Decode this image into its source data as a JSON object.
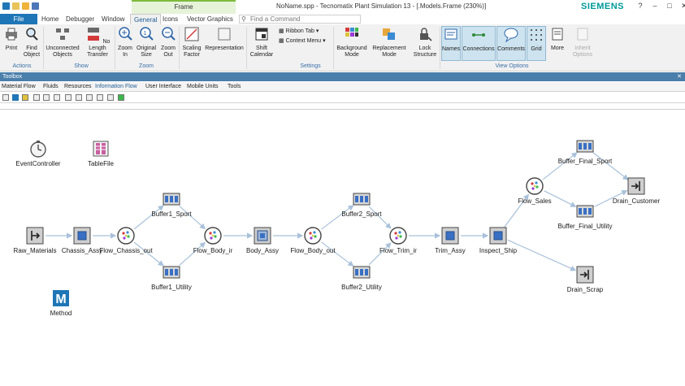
{
  "titlebar": {
    "context_tab": "Frame",
    "document_title": "NoName.spp - Tecnomatix Plant Simulation 13 - [.Models.Frame  (230%)]",
    "brand": "SIEMENS",
    "minimize": "?",
    "restore": "–",
    "maximize": "□",
    "close": "✕"
  },
  "ribbon_tabs": [
    "File",
    "Home",
    "Debugger",
    "Window",
    "General",
    "Icons",
    "Vector Graphics"
  ],
  "search": {
    "placeholder": "Find a Command"
  },
  "ribbon": {
    "buttons": [
      {
        "label": "Print",
        "icon": "printer-icon"
      },
      {
        "label": "Find Object",
        "icon": "find-icon"
      },
      {
        "label": "Unconnected Objects",
        "icon": "unconnected-icon"
      },
      {
        "label": "No Length Transfer",
        "icon": "transfer-icon"
      },
      {
        "label": "Zoom In",
        "icon": "zoom-in-icon"
      },
      {
        "label": "Original Size",
        "icon": "zoom-original-icon"
      },
      {
        "label": "Zoom Out",
        "icon": "zoom-out-icon"
      },
      {
        "label": "Scaling Factor",
        "icon": "scaling-icon"
      },
      {
        "label": "Representation",
        "icon": "representation-icon"
      },
      {
        "label": "Shift Calendar",
        "icon": "calendar-icon"
      },
      {
        "label": "Background Mode",
        "icon": "palette-icon"
      },
      {
        "label": "Replacement Mode",
        "icon": "replacement-icon"
      },
      {
        "label": "Lock Structure",
        "icon": "lock-icon"
      },
      {
        "label": "Names",
        "icon": "names-icon"
      },
      {
        "label": "Connections",
        "icon": "connections-icon"
      },
      {
        "label": "Comments",
        "icon": "comments-icon"
      },
      {
        "label": "Grid",
        "icon": "grid-icon"
      },
      {
        "label": "More",
        "icon": "more-icon"
      },
      {
        "label": "Inherit Options",
        "icon": "inherit-icon"
      }
    ],
    "small_items": [
      "Ribbon Tab",
      "Context Menu"
    ],
    "groups": [
      "Actions",
      "Show",
      "Zoom",
      "Settings",
      "View Options"
    ]
  },
  "toolbox": {
    "title": "Toolbox",
    "close": "✕",
    "tabs": [
      "Material Flow",
      "Fluids",
      "Resources",
      "Information Flow",
      "User Interface",
      "Mobile Units",
      "Tools"
    ],
    "active_tab": "Information Flow"
  },
  "model": {
    "nodes": [
      {
        "id": "EventController",
        "label": "EventController",
        "kind": "event-controller"
      },
      {
        "id": "TableFile",
        "label": "TableFile",
        "kind": "table"
      },
      {
        "id": "Method",
        "label": "Method",
        "kind": "method"
      },
      {
        "id": "Raw_Materials",
        "label": "Raw_Materials",
        "kind": "source"
      },
      {
        "id": "Chassis_Assy",
        "label": "Chassis_Assy",
        "kind": "station"
      },
      {
        "id": "Flow_Chassis_out",
        "label": "Flow_Chassis_out",
        "kind": "flow"
      },
      {
        "id": "Buffer1_Sport",
        "label": "Buffer1_Sport",
        "kind": "buffer"
      },
      {
        "id": "Buffer1_Utility",
        "label": "Buffer1_Utility",
        "kind": "buffer"
      },
      {
        "id": "Flow_Body_in",
        "label": "Flow_Body_ir",
        "kind": "flow"
      },
      {
        "id": "Body_Assy",
        "label": "Body_Assy",
        "kind": "assembly"
      },
      {
        "id": "Flow_Body_out",
        "label": "Flow_Body_out",
        "kind": "flow"
      },
      {
        "id": "Buffer2_Sport",
        "label": "Buffer2_Sport",
        "kind": "buffer"
      },
      {
        "id": "Buffer2_Utility",
        "label": "Buffer2_Utility",
        "kind": "buffer"
      },
      {
        "id": "Flow_Trim_in",
        "label": "Flow_Trim_ir",
        "kind": "flow"
      },
      {
        "id": "Trim_Assy",
        "label": "Trim_Assy",
        "kind": "station"
      },
      {
        "id": "Inspect_Ship",
        "label": "Inspect_Ship",
        "kind": "station"
      },
      {
        "id": "Flow_Sales",
        "label": "Flow_Sales",
        "kind": "flow"
      },
      {
        "id": "Buffer_Final_Sport",
        "label": "Buffer_Final_Sport",
        "kind": "buffer"
      },
      {
        "id": "Buffer_Final_Utility",
        "label": "Buffer_Final_Utility",
        "kind": "buffer"
      },
      {
        "id": "Drain_Customer",
        "label": "Drain_Customer",
        "kind": "drain"
      },
      {
        "id": "Drain_Scrap",
        "label": "Drain_Scrap",
        "kind": "drain"
      }
    ],
    "connections": [
      [
        "Raw_Materials",
        "Chassis_Assy"
      ],
      [
        "Chassis_Assy",
        "Flow_Chassis_out"
      ],
      [
        "Flow_Chassis_out",
        "Buffer1_Sport"
      ],
      [
        "Flow_Chassis_out",
        "Buffer1_Utility"
      ],
      [
        "Buffer1_Sport",
        "Flow_Body_in"
      ],
      [
        "Buffer1_Utility",
        "Flow_Body_in"
      ],
      [
        "Flow_Body_in",
        "Body_Assy"
      ],
      [
        "Body_Assy",
        "Flow_Body_out"
      ],
      [
        "Flow_Body_out",
        "Buffer2_Sport"
      ],
      [
        "Flow_Body_out",
        "Buffer2_Utility"
      ],
      [
        "Buffer2_Sport",
        "Flow_Trim_in"
      ],
      [
        "Buffer2_Utility",
        "Flow_Trim_in"
      ],
      [
        "Flow_Trim_in",
        "Trim_Assy"
      ],
      [
        "Trim_Assy",
        "Inspect_Ship"
      ],
      [
        "Inspect_Ship",
        "Flow_Sales"
      ],
      [
        "Inspect_Ship",
        "Drain_Scrap"
      ],
      [
        "Flow_Sales",
        "Buffer_Final_Sport"
      ],
      [
        "Flow_Sales",
        "Buffer_Final_Utility"
      ],
      [
        "Buffer_Final_Sport",
        "Drain_Customer"
      ],
      [
        "Buffer_Final_Utility",
        "Drain_Customer"
      ]
    ]
  },
  "colors": {
    "file_tab": "#1f76b6",
    "toolbox_bar": "#4a7eab",
    "brand": "#009999",
    "connection": "#a9c1d9",
    "selected_option": "#cde3ef"
  }
}
